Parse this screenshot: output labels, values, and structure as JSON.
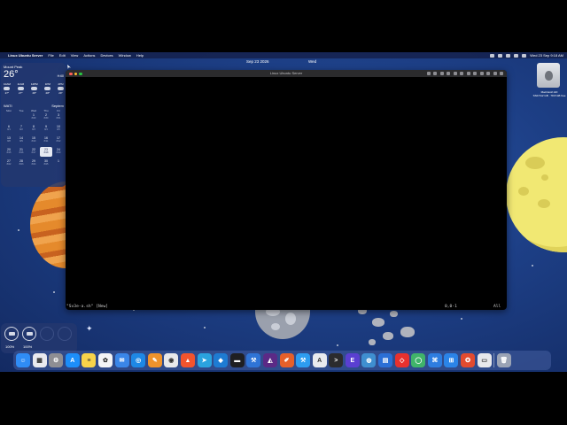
{
  "menubar": {
    "items": [
      "Linux Ubuntu Server",
      "File",
      "Edit",
      "View",
      "Actions",
      "Devices",
      "Window",
      "Help"
    ],
    "clock": "Wed 23 Sep 9:18 AM"
  },
  "stage_date": {
    "date": "Sep 23 2026",
    "day": "Wed"
  },
  "weather": {
    "location": "Mount Peak",
    "temperature": "26°",
    "condition": "H:68",
    "hours": [
      {
        "time": "10AM",
        "temp": "27°"
      },
      {
        "time": "11AM",
        "temp": "27°"
      },
      {
        "time": "12PM",
        "temp": "28°"
      },
      {
        "time": "1PM",
        "temp": "28°"
      },
      {
        "time": "2PM",
        "temp": "29°"
      }
    ]
  },
  "calendar": {
    "month_left": "WATI",
    "month_right": "Septem",
    "weekdays": [
      "Mon",
      "Tue",
      "Wed",
      "Thu",
      "Fri"
    ],
    "days": [
      {
        "d": "",
        "s": ""
      },
      {
        "d": "",
        "s": ""
      },
      {
        "d": "1",
        "s": "8/29"
      },
      {
        "d": "2",
        "s": "8/30"
      },
      {
        "d": "3",
        "s": "8/31"
      },
      {
        "d": "6",
        "s": "8/1"
      },
      {
        "d": "7",
        "s": "8/2"
      },
      {
        "d": "8",
        "s": "8/3"
      },
      {
        "d": "9",
        "s": "8/4"
      },
      {
        "d": "10",
        "s": "8/5"
      },
      {
        "d": "13",
        "s": "8/8"
      },
      {
        "d": "14",
        "s": "8/9"
      },
      {
        "d": "15",
        "s": "8/10"
      },
      {
        "d": "16",
        "s": "8/11"
      },
      {
        "d": "17",
        "s": "8/12"
      },
      {
        "d": "20",
        "s": "8/15"
      },
      {
        "d": "21",
        "s": "8/16"
      },
      {
        "d": "22",
        "s": "8/17"
      },
      {
        "d": "23",
        "s": "8/18"
      },
      {
        "d": "24",
        "s": "8/19"
      },
      {
        "d": "27",
        "s": "8/22"
      },
      {
        "d": "28",
        "s": "8/23"
      },
      {
        "d": "29",
        "s": "8/24"
      },
      {
        "d": "30",
        "s": "8/25"
      },
      {
        "d": "1",
        "s": ""
      }
    ],
    "today": "23"
  },
  "battery": {
    "left": "100%",
    "right": "100%"
  },
  "desktop_item": {
    "label": "Macintosh HD",
    "sublabel": "SSD 512 GB · 78.8 GB free"
  },
  "window": {
    "title": "Linux Ubuntu Server",
    "vim_file": "\"Sv3e-a.sh\" [New]",
    "vim_pos": "0,0-1",
    "vim_scroll": "All"
  },
  "dock": [
    {
      "name": "finder-icon",
      "color": "#2f8cf5",
      "glyph": "☺"
    },
    {
      "name": "launchpad-icon",
      "color": "#e9e9ee",
      "glyph": "▦"
    },
    {
      "name": "system-settings-icon",
      "color": "#8e8e93",
      "glyph": "⚙"
    },
    {
      "name": "app-store-icon",
      "color": "#1c8ef9",
      "glyph": "A"
    },
    {
      "name": "notes-icon",
      "color": "#f8d34a",
      "glyph": "≡"
    },
    {
      "name": "photos-icon",
      "color": "#f4f4f6",
      "glyph": "✿"
    },
    {
      "name": "mail-icon",
      "color": "#3a86e8",
      "glyph": "✉"
    },
    {
      "name": "safari-icon",
      "color": "#1e88e5",
      "glyph": "◎"
    },
    {
      "name": "pages-icon",
      "color": "#f0932b",
      "glyph": "✎"
    },
    {
      "name": "chrome-icon",
      "color": "#e8e8ea",
      "glyph": "◉"
    },
    {
      "name": "brave-icon",
      "color": "#f2542d",
      "glyph": "▲"
    },
    {
      "name": "telegram-icon",
      "color": "#2aa3df",
      "glyph": "➤"
    },
    {
      "name": "vscode-icon",
      "color": "#1e7bd2",
      "glyph": "◆"
    },
    {
      "name": "terminal-black-icon",
      "color": "#1f1f22",
      "glyph": "▬"
    },
    {
      "name": "xcode-icon",
      "color": "#2f74d6",
      "glyph": "⚒"
    },
    {
      "name": "affinity-icon",
      "color": "#5b2a86",
      "glyph": "◭"
    },
    {
      "name": "pen-tool-icon",
      "color": "#e6602a",
      "glyph": "✐"
    },
    {
      "name": "xcode-hammer-icon",
      "color": "#2d9cf0",
      "glyph": "⚒"
    },
    {
      "name": "text-editor-icon",
      "color": "#e9eaee",
      "glyph": "A"
    },
    {
      "name": "terminal-icon",
      "color": "#2b2b2e",
      "glyph": ">"
    },
    {
      "name": "eo-icon",
      "color": "#5a3fd1",
      "glyph": "E"
    },
    {
      "name": "database-icon",
      "color": "#3f8fd0",
      "glyph": "◍"
    },
    {
      "name": "file-manager-icon",
      "color": "#2b6fd6",
      "glyph": "▤"
    },
    {
      "name": "anydesk-icon",
      "color": "#e8312e",
      "glyph": "◇"
    },
    {
      "name": "git-client-icon",
      "color": "#40b36a",
      "glyph": "◯"
    },
    {
      "name": "flow-icon",
      "color": "#2e7de0",
      "glyph": "⌘"
    },
    {
      "name": "windows-app-icon",
      "color": "#2b84e8",
      "glyph": "⊞"
    },
    {
      "name": "adobe-icon",
      "color": "#e24b2f",
      "glyph": "✪"
    },
    {
      "name": "preview-icon",
      "color": "#e7e8ec",
      "glyph": "▭"
    },
    {
      "name": "trash-icon",
      "color": "#9aa3b5",
      "glyph": "🗑"
    }
  ]
}
